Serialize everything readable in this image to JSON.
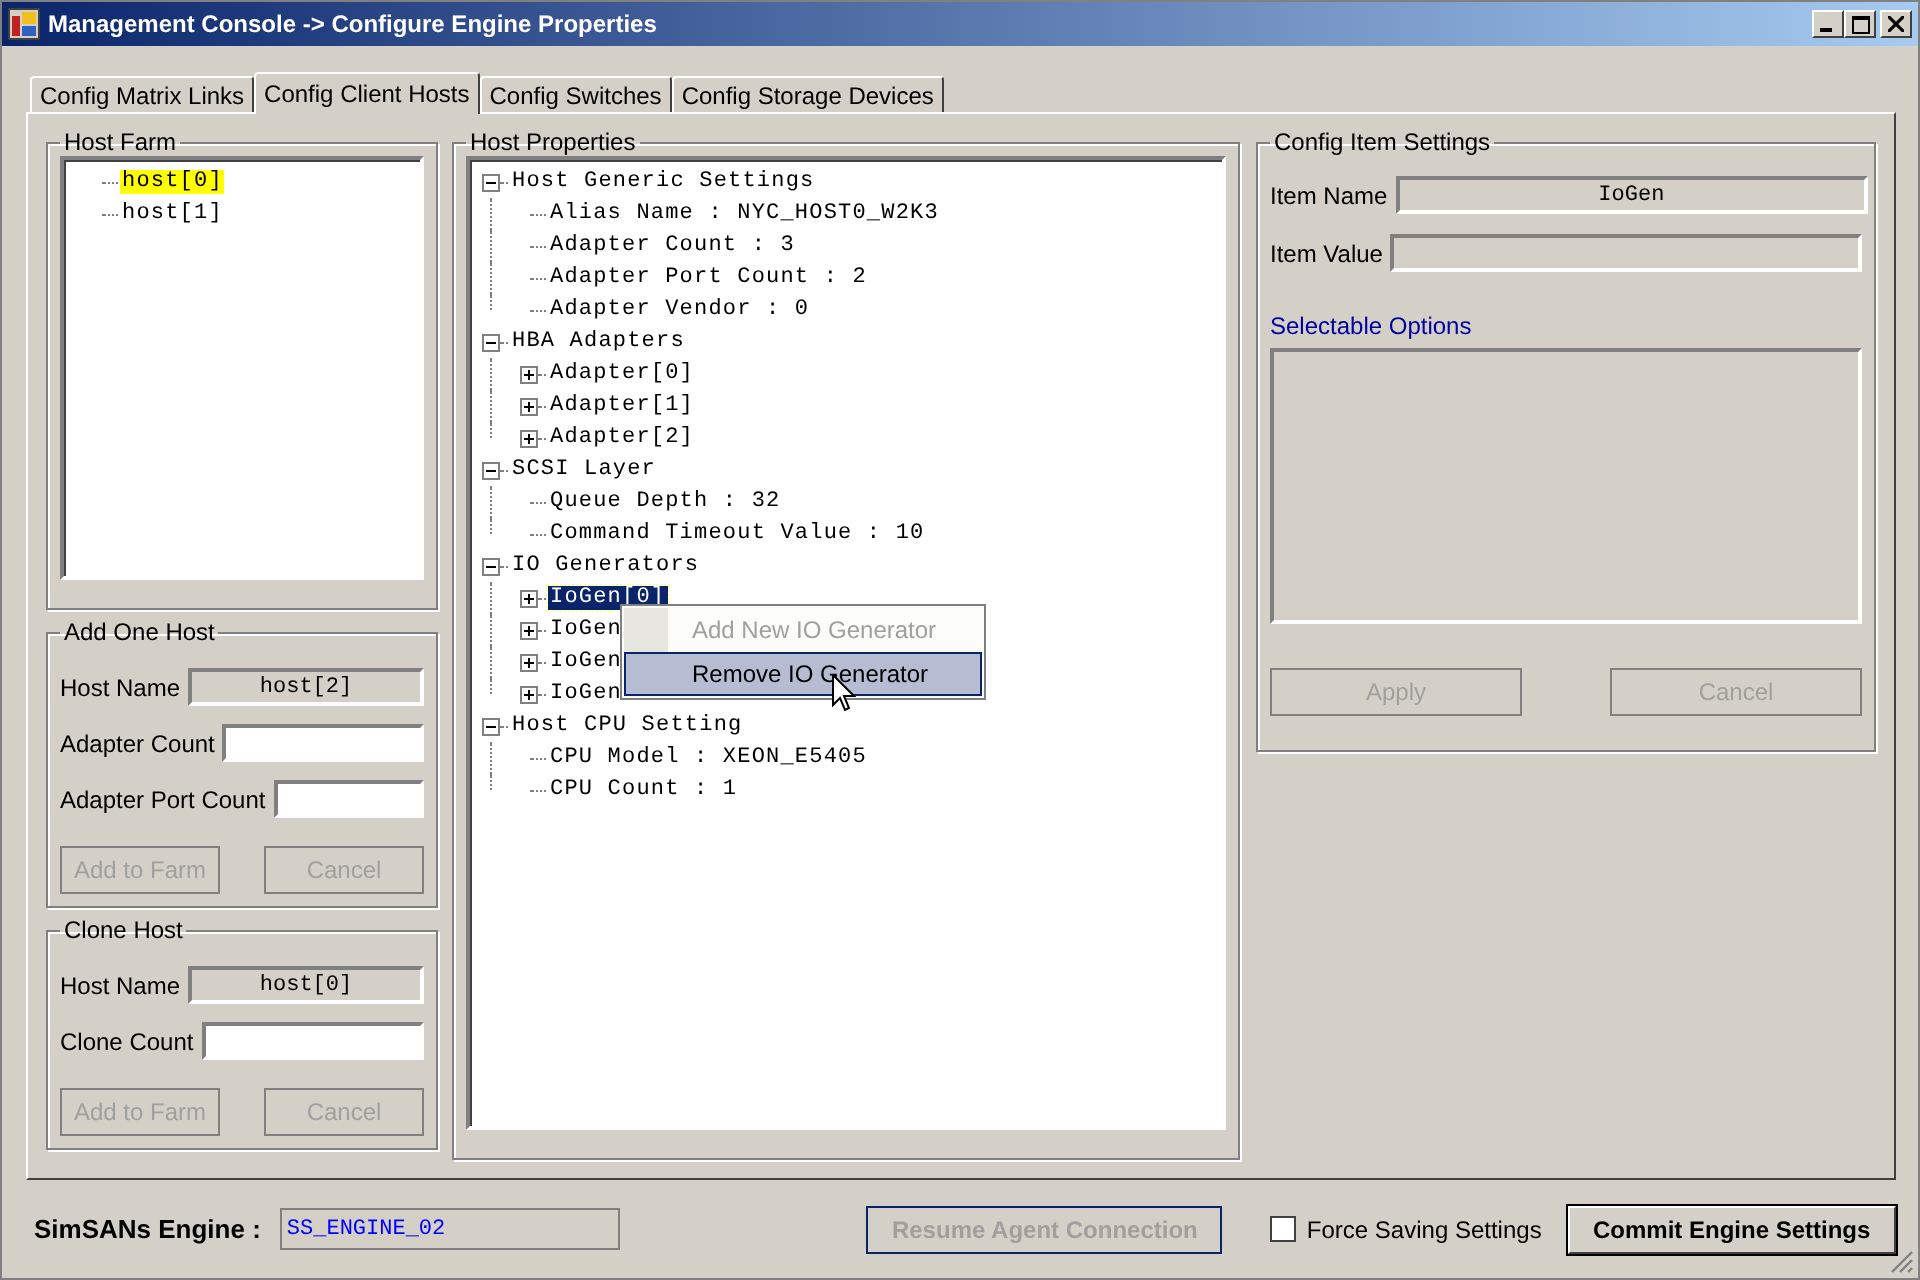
{
  "window": {
    "title": "Management Console -> Configure Engine Properties"
  },
  "tabs": [
    {
      "label": "Config Matrix Links",
      "selected": false
    },
    {
      "label": "Config Client Hosts",
      "selected": true
    },
    {
      "label": "Config Switches",
      "selected": false
    },
    {
      "label": "Config Storage Devices",
      "selected": false
    }
  ],
  "host_farm": {
    "title": "Host Farm",
    "tree": [
      {
        "label": "host[0]",
        "selected": true
      },
      {
        "label": "host[1]",
        "selected": false
      }
    ]
  },
  "add_one_host": {
    "title": "Add One Host",
    "fields": [
      {
        "label": "Host Name",
        "value": "host[2]",
        "readonly": true
      },
      {
        "label": "Adapter Count",
        "readonly": false
      },
      {
        "label": "Adapter Port Count",
        "readonly": false
      }
    ],
    "buttons": [
      {
        "label": "Add to Farm",
        "disabled": true
      },
      {
        "label": "Cancel",
        "disabled": true
      }
    ]
  },
  "clone_host": {
    "title": "Clone Host",
    "fields": [
      {
        "label": "Host Name",
        "value": "host[0]",
        "readonly": true
      },
      {
        "label": "Clone Count",
        "readonly": false
      }
    ],
    "buttons": [
      {
        "label": "Add to Farm",
        "disabled": true
      },
      {
        "label": "Cancel",
        "disabled": true
      }
    ]
  },
  "host_properties": {
    "title": "Host Properties",
    "tree": [
      {
        "label": "Host Generic Settings",
        "expanded": true,
        "selected": false,
        "children": [
          {
            "label": "Alias Name : NYC_HOST0_W2K3",
            "selected": false
          },
          {
            "label": "Adapter Count : 3",
            "selected": false
          },
          {
            "label": "Adapter Port Count : 2",
            "selected": false
          },
          {
            "label": "Adapter Vendor : 0",
            "selected": false
          }
        ]
      },
      {
        "label": "HBA Adapters",
        "expanded": true,
        "selected": false,
        "children": [
          {
            "label": "Adapter[0]",
            "expanded": false,
            "selected": false
          },
          {
            "label": "Adapter[1]",
            "expanded": false,
            "selected": false
          },
          {
            "label": "Adapter[2]",
            "expanded": false,
            "selected": false
          }
        ]
      },
      {
        "label": "SCSI Layer",
        "expanded": true,
        "selected": false,
        "children": [
          {
            "label": "Queue Depth : 32",
            "selected": false
          },
          {
            "label": "Command Timeout Value : 10",
            "selected": false
          }
        ]
      },
      {
        "label": "IO Generators",
        "expanded": true,
        "selected": false,
        "children": [
          {
            "label": "IoGen[0]",
            "expanded": false,
            "selected": true
          },
          {
            "label": "IoGen",
            "expanded": false,
            "selected": false
          },
          {
            "label": "IoGen",
            "expanded": false,
            "selected": false
          },
          {
            "label": "IoGen",
            "expanded": false,
            "selected": false
          }
        ]
      },
      {
        "label": "Host CPU Setting",
        "expanded": true,
        "selected": false,
        "children": [
          {
            "label": "CPU Model : XEON_E5405",
            "selected": false
          },
          {
            "label": "CPU Count : 1",
            "selected": false
          }
        ]
      }
    ]
  },
  "context_menu": [
    {
      "label": "Add New IO Generator",
      "disabled": true,
      "selected": false
    },
    {
      "label": "Remove IO Generator",
      "disabled": false,
      "selected": true
    }
  ],
  "config_item_settings": {
    "title": "Config Item Settings",
    "fields": [
      {
        "label": "Item Name",
        "value": "IoGen",
        "readonly": true
      },
      {
        "label": "Item Value",
        "readonly": true
      }
    ],
    "options_label": "Selectable Options",
    "buttons": [
      {
        "label": "Apply",
        "disabled": true
      },
      {
        "label": "Cancel",
        "disabled": true
      }
    ]
  },
  "bottom_bar": {
    "engine_label": "SimSANs Engine :",
    "engine_value": "SS_ENGINE_02",
    "resume_button": {
      "label": "Resume Agent Connection",
      "disabled": true
    },
    "force_saving": {
      "label": "Force Saving Settings",
      "checked": false
    },
    "commit_button": {
      "label": "Commit Engine Settings",
      "disabled": false
    }
  }
}
